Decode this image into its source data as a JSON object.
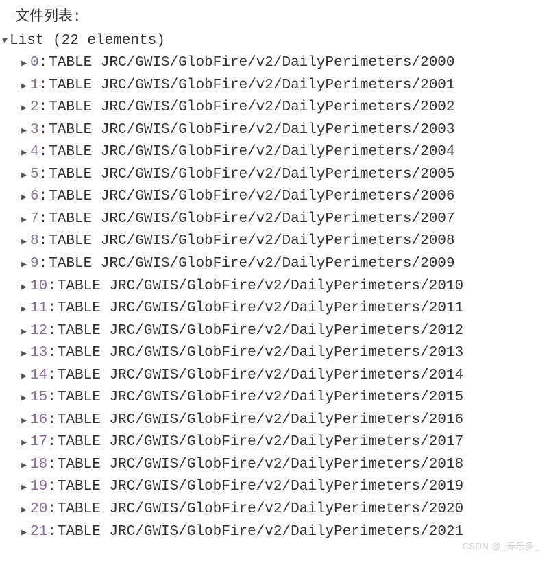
{
  "title": "文件列表:",
  "list": {
    "header_text": "List (22 elements)",
    "items": [
      {
        "idx": "0",
        "value": "TABLE JRC/GWIS/GlobFire/v2/DailyPerimeters/2000"
      },
      {
        "idx": "1",
        "value": "TABLE JRC/GWIS/GlobFire/v2/DailyPerimeters/2001"
      },
      {
        "idx": "2",
        "value": "TABLE JRC/GWIS/GlobFire/v2/DailyPerimeters/2002"
      },
      {
        "idx": "3",
        "value": "TABLE JRC/GWIS/GlobFire/v2/DailyPerimeters/2003"
      },
      {
        "idx": "4",
        "value": "TABLE JRC/GWIS/GlobFire/v2/DailyPerimeters/2004"
      },
      {
        "idx": "5",
        "value": "TABLE JRC/GWIS/GlobFire/v2/DailyPerimeters/2005"
      },
      {
        "idx": "6",
        "value": "TABLE JRC/GWIS/GlobFire/v2/DailyPerimeters/2006"
      },
      {
        "idx": "7",
        "value": "TABLE JRC/GWIS/GlobFire/v2/DailyPerimeters/2007"
      },
      {
        "idx": "8",
        "value": "TABLE JRC/GWIS/GlobFire/v2/DailyPerimeters/2008"
      },
      {
        "idx": "9",
        "value": "TABLE JRC/GWIS/GlobFire/v2/DailyPerimeters/2009"
      },
      {
        "idx": "10",
        "value": "TABLE JRC/GWIS/GlobFire/v2/DailyPerimeters/2010"
      },
      {
        "idx": "11",
        "value": "TABLE JRC/GWIS/GlobFire/v2/DailyPerimeters/2011"
      },
      {
        "idx": "12",
        "value": "TABLE JRC/GWIS/GlobFire/v2/DailyPerimeters/2012"
      },
      {
        "idx": "13",
        "value": "TABLE JRC/GWIS/GlobFire/v2/DailyPerimeters/2013"
      },
      {
        "idx": "14",
        "value": "TABLE JRC/GWIS/GlobFire/v2/DailyPerimeters/2014"
      },
      {
        "idx": "15",
        "value": "TABLE JRC/GWIS/GlobFire/v2/DailyPerimeters/2015"
      },
      {
        "idx": "16",
        "value": "TABLE JRC/GWIS/GlobFire/v2/DailyPerimeters/2016"
      },
      {
        "idx": "17",
        "value": "TABLE JRC/GWIS/GlobFire/v2/DailyPerimeters/2017"
      },
      {
        "idx": "18",
        "value": "TABLE JRC/GWIS/GlobFire/v2/DailyPerimeters/2018"
      },
      {
        "idx": "19",
        "value": "TABLE JRC/GWIS/GlobFire/v2/DailyPerimeters/2019"
      },
      {
        "idx": "20",
        "value": "TABLE JRC/GWIS/GlobFire/v2/DailyPerimeters/2020"
      },
      {
        "idx": "21",
        "value": "TABLE JRC/GWIS/GlobFire/v2/DailyPerimeters/2021"
      }
    ]
  },
  "watermark": "CSDN @_养乐多_"
}
